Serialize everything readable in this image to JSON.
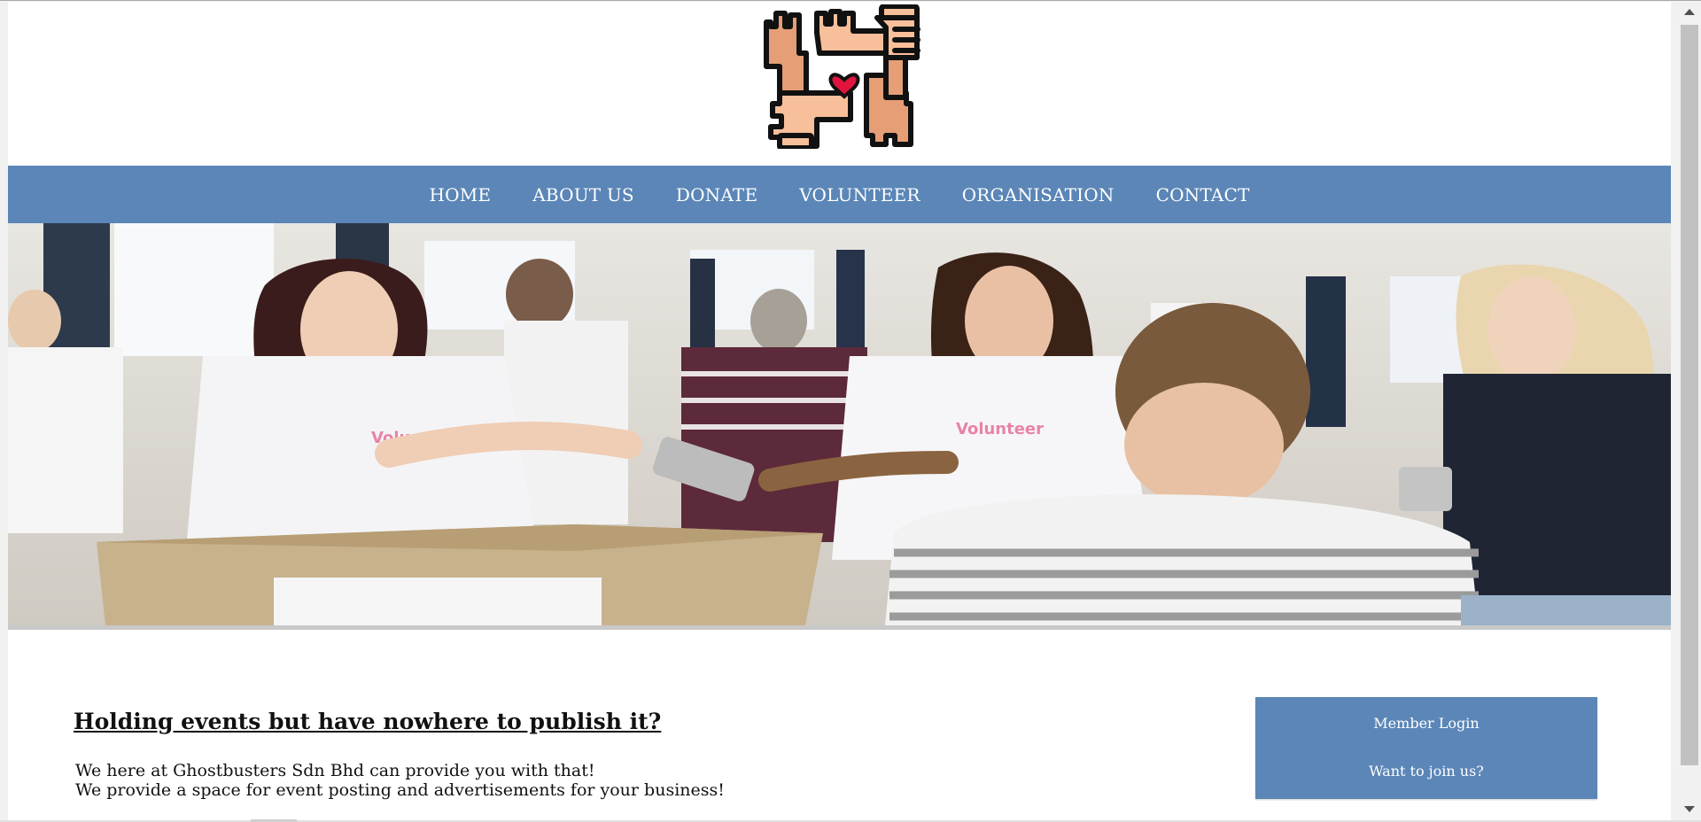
{
  "nav": {
    "items": [
      {
        "label": "HOME"
      },
      {
        "label": "ABOUT US"
      },
      {
        "label": "DONATE"
      },
      {
        "label": "VOLUNTEER"
      },
      {
        "label": "ORGANISATION"
      },
      {
        "label": "CONTACT"
      }
    ]
  },
  "logo": {
    "icon": "hands-heart-icon",
    "colors": {
      "skin": "#f7bf9a",
      "skin_dark": "#e59e75",
      "outline": "#111111",
      "heart": "#e0143c"
    }
  },
  "hero": {
    "shirt_text": "Volunteer",
    "shirt_text_color": "#e883a6"
  },
  "content": {
    "heading": "Holding events but have nowhere to publish it?",
    "paragraph_lines": [
      "We here at Ghostbusters Sdn Bhd can provide you with that!",
      "We provide a space for event posting and advertisements for your business!"
    ]
  },
  "sidebar": {
    "member_login_label": "Member Login",
    "join_label": "Want to join us?"
  },
  "colors": {
    "accent": "#5b86b7",
    "text": "#111111",
    "background": "#ffffff"
  }
}
